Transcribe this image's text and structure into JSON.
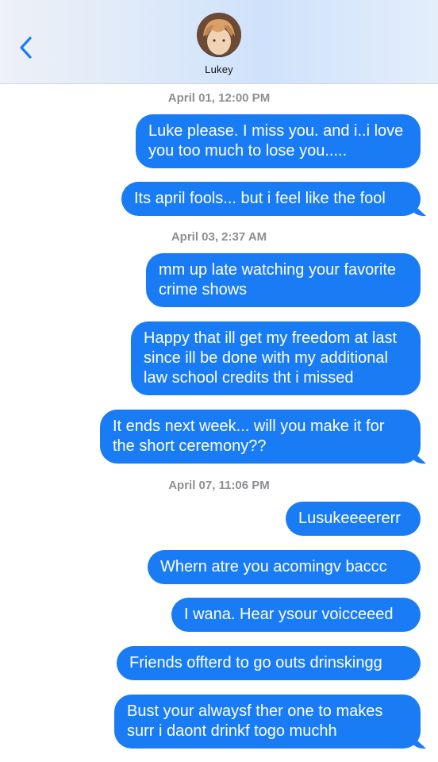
{
  "header": {
    "contact_name": "Lukey",
    "back_icon": "chevron-left-icon",
    "accent_color": "#1a7cf5"
  },
  "thread": {
    "timestamps": [
      "April 01, 12:00 PM",
      "April 03, 2:37 AM",
      "April 07, 11:06 PM"
    ],
    "messages": [
      "Luke please. I miss you. and i..i love\nyou too much to lose you.....",
      "Its april fools... but i feel like the fool",
      "mm up late watching your favorite\ncrime shows",
      "Happy that ill get my freedom at last\nsince ill be done with my additional\nlaw school credits tht i missed",
      "It ends next week... will you make it for\nthe short ceremony??",
      "Lusukeeeererr",
      "Whern atre you acomingv baccc",
      "I wana. Hear ysour voicceeed",
      "Friends offterd to go outs drinskingg",
      "Bust your alwaysf ther one to makes\nsurr i daont drinkf togo muchh"
    ]
  }
}
